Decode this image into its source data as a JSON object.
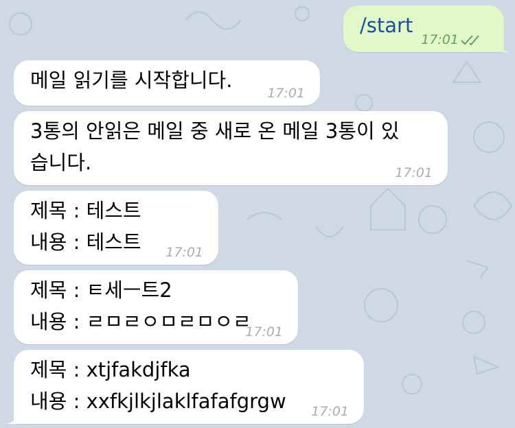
{
  "chat": {
    "outgoing": {
      "text": "/start",
      "time": "17:01",
      "status_icon": "double-check-icon"
    },
    "messages": [
      {
        "lines": [
          "메일 읽기를 시작합니다."
        ],
        "time": "17:01"
      },
      {
        "lines": [
          "3통의 안읽은 메일 중 새로 온 메일 3통이 있",
          "습니다."
        ],
        "time": "17:01"
      },
      {
        "lines": [
          "제목 : 테스트",
          "내용 : 테스트"
        ],
        "time": "17:01"
      },
      {
        "lines": [
          "제목 : ㅌ세ㅡ트2",
          "내용 : ㄹㅁㄹㅇㅁㄹㅁㅇㄹ"
        ],
        "time": "17:01"
      },
      {
        "lines": [
          "제목 : xtjfakdjfka",
          "내용 : xxfkjlkjlaklfafafgrgw"
        ],
        "time": "17:01"
      }
    ]
  },
  "colors": {
    "background": "#cfd9e6",
    "incoming_bubble": "#ffffff",
    "outgoing_bubble": "#e2f8c8",
    "outgoing_text": "#1c4f9b",
    "timestamp": "#a6adb6",
    "read_checks": "#5fa35a"
  }
}
